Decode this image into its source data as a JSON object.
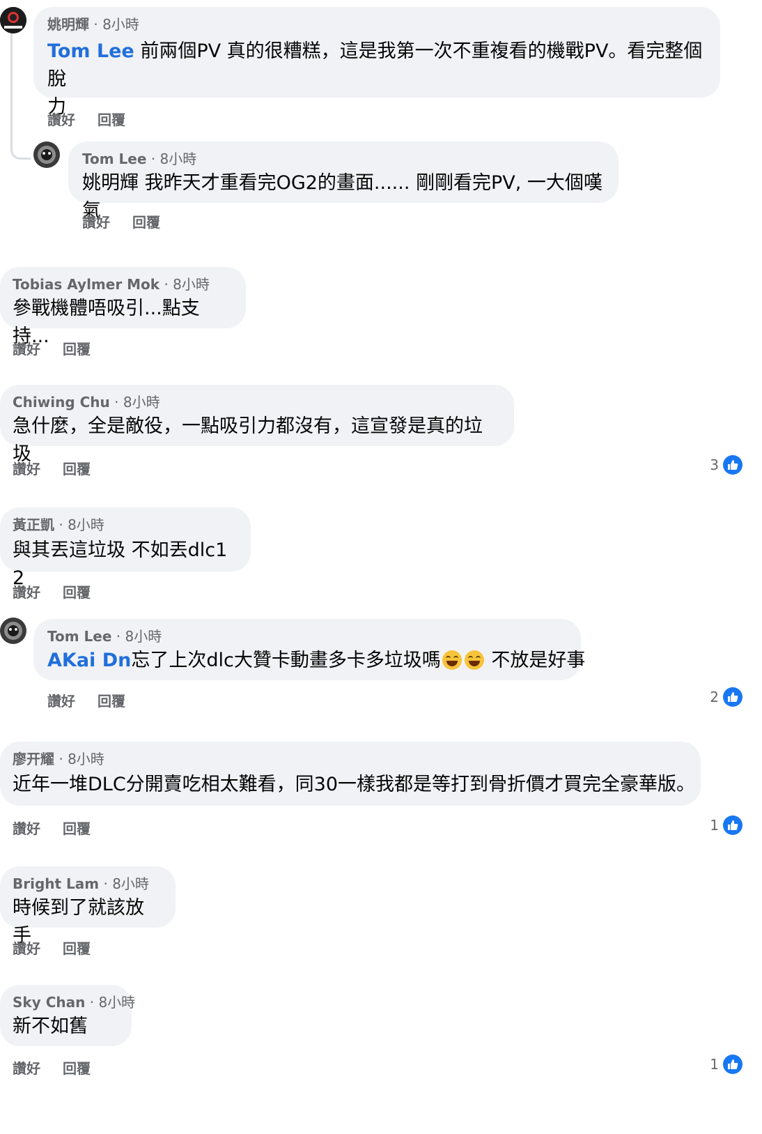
{
  "comments": [
    {
      "author": "姚明輝",
      "time": "8小時",
      "mention": "Tom Lee",
      "text_line1": " 前兩個PV 真的很糟糕，這是我第一次不重複看的機戰PV。看完整個脫",
      "text_line2": "力",
      "like_label": "讚好",
      "reply_label": "回覆"
    },
    {
      "author": "Tom Lee",
      "time": "8小時",
      "text": "姚明輝 我昨天才重看完OG2的畫面...... 剛剛看完PV, 一大個嘆氣",
      "like_label": "讚好",
      "reply_label": "回覆"
    },
    {
      "author": "Tobias Aylmer Mok",
      "time": "8小時",
      "text": "參戰機體唔吸引...點支持...",
      "like_label": "讚好",
      "reply_label": "回覆"
    },
    {
      "author": "Chiwing Chu",
      "time": "8小時",
      "text": "急什麼，全是敵役，一點吸引力都沒有，這宣發是真的垃圾",
      "like_label": "讚好",
      "reply_label": "回覆",
      "reaction_count": "3"
    },
    {
      "author": "黃正凱",
      "time": "8小時",
      "text": "與其丟這垃圾 不如丟dlc1 2",
      "like_label": "讚好",
      "reply_label": "回覆"
    },
    {
      "author": "Tom Lee",
      "time": "8小時",
      "mention": "AKai Dn",
      "text_before_emoji": "忘了上次dlc大贊卡動畫多卡多垃圾嗎",
      "text_after_emoji": " 不放是好事",
      "emoji": "laughing-emoji",
      "like_label": "讚好",
      "reply_label": "回覆",
      "reaction_count": "2"
    },
    {
      "author": "廖开耀",
      "time": "8小時",
      "text": "近年一堆DLC分開賣吃相太難看，同30一樣我都是等打到骨折價才買完全豪華版。",
      "like_label": "讚好",
      "reply_label": "回覆",
      "reaction_count": "1"
    },
    {
      "author": "Bright Lam",
      "time": "8小時",
      "text": "時候到了就該放手",
      "like_label": "讚好",
      "reply_label": "回覆"
    },
    {
      "author": "Sky Chan",
      "time": "8小時",
      "text": "新不如舊",
      "like_label": "讚好",
      "reply_label": "回覆",
      "reaction_count": "1"
    }
  ],
  "separator": " · ",
  "icons": {
    "like": "thumbs-up-icon",
    "avatar_a": "logo-avatar",
    "avatar_b": "dark-character-avatar"
  },
  "colors": {
    "bubble": "#f0f2f5",
    "mention": "#216fdb",
    "meta": "#65676b",
    "like_badge": "#1877f2"
  }
}
